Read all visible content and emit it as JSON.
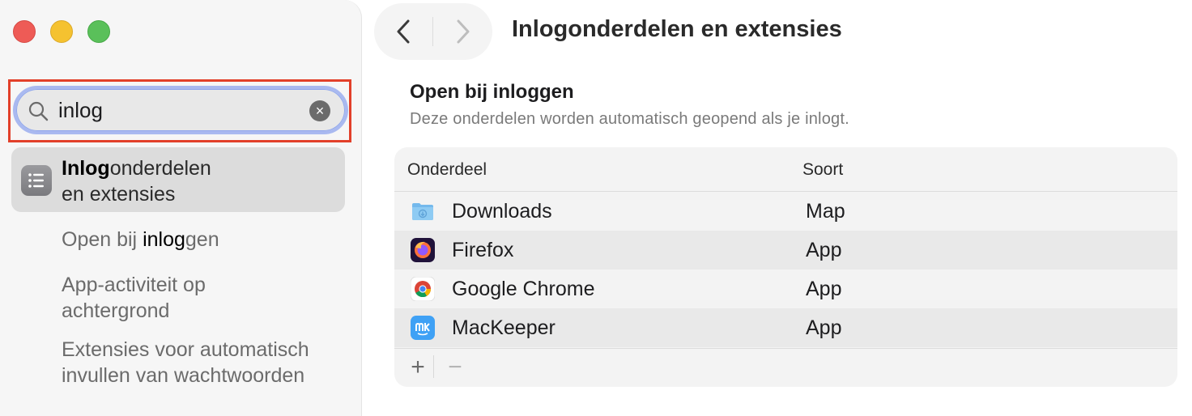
{
  "window": {
    "controls": [
      "close",
      "minimize",
      "zoom"
    ]
  },
  "search": {
    "value": "inlog",
    "clear_icon": "×"
  },
  "sidebar": {
    "selected_result": {
      "icon": "list-icon",
      "title_match": "Inlog",
      "title_rest_line1": "onderdelen",
      "title_line2": "en extensies"
    },
    "results": [
      {
        "before": "Open bij ",
        "match": "inlog",
        "after": "gen"
      },
      {
        "line1": "App-activiteit op",
        "line2": "achtergrond"
      },
      {
        "line1": "Extensies voor automatisch",
        "line2": "invullen van wachtwoorden"
      }
    ]
  },
  "nav": {
    "back_icon": "chevron-left-icon",
    "forward_icon": "chevron-right-icon"
  },
  "page": {
    "title": "Inlogonderdelen en extensies",
    "section_title": "Open bij inloggen",
    "section_subtitle": "Deze onderdelen worden automatisch geopend als je inlogt."
  },
  "table": {
    "headers": {
      "item": "Onderdeel",
      "kind": "Soort"
    },
    "rows": [
      {
        "name": "Downloads",
        "kind": "Map",
        "icon": "folder-downloads-icon"
      },
      {
        "name": "Firefox",
        "kind": "App",
        "icon": "firefox-icon"
      },
      {
        "name": "Google Chrome",
        "kind": "App",
        "icon": "chrome-icon"
      },
      {
        "name": "MacKeeper",
        "kind": "App",
        "icon": "mackeeper-icon"
      }
    ],
    "add_label": "+",
    "remove_label": "−"
  },
  "colors": {
    "highlight_border": "#e2402a",
    "search_focus": "#a9b9f0",
    "selected_row": "#dcdcdc"
  }
}
